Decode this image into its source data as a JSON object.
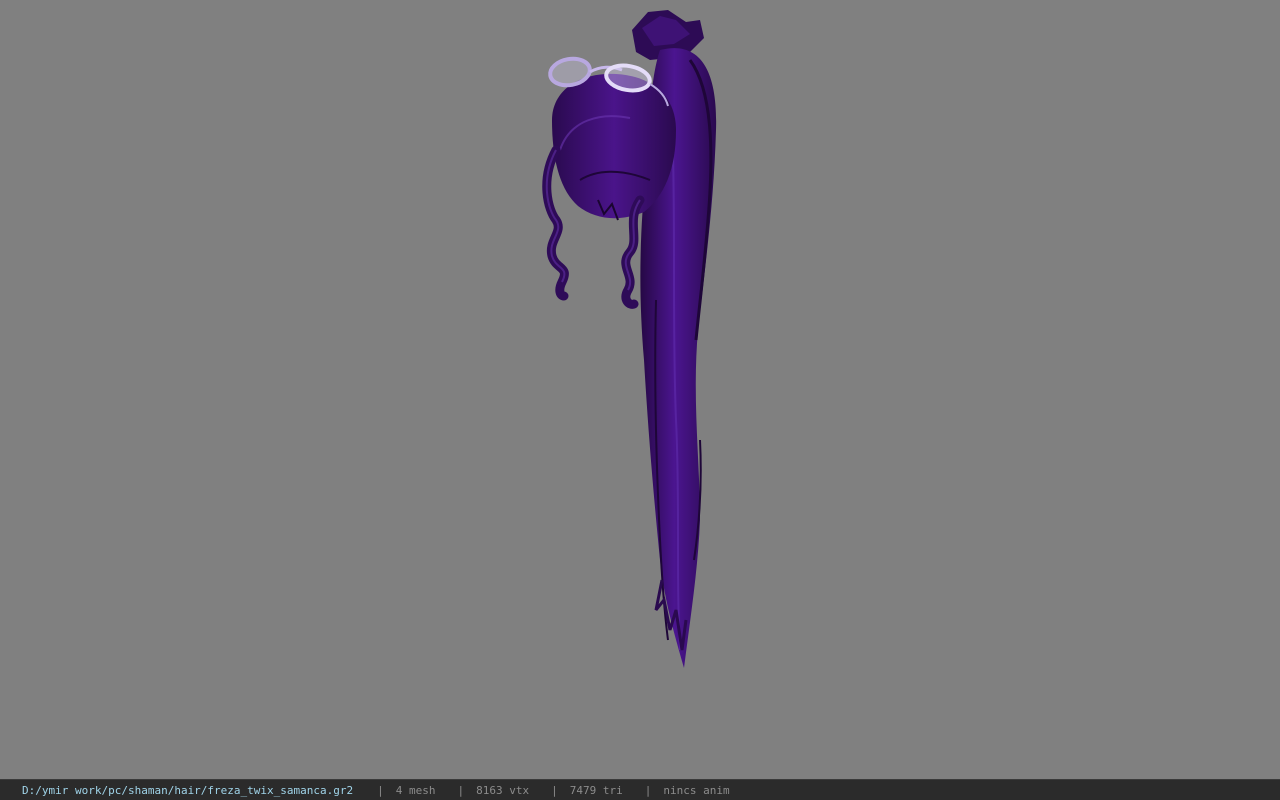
{
  "viewport": {
    "background_color": "#808080",
    "model_colors": {
      "hair_dark": "#2a0a4f",
      "hair_mid": "#3d0f72",
      "hair_light": "#5a2a9a",
      "glasses_frame": "#b8a8e0",
      "glasses_lens": "#d8d0f0"
    }
  },
  "status_bar": {
    "file_path": "D:/ymir work/pc/shaman/hair/freza_twix_samanca.gr2",
    "separator": "|",
    "mesh_count": "4 mesh",
    "vertex_count": "8163 vtx",
    "triangle_count": "7479 tri",
    "anim_status": "nincs anim"
  }
}
